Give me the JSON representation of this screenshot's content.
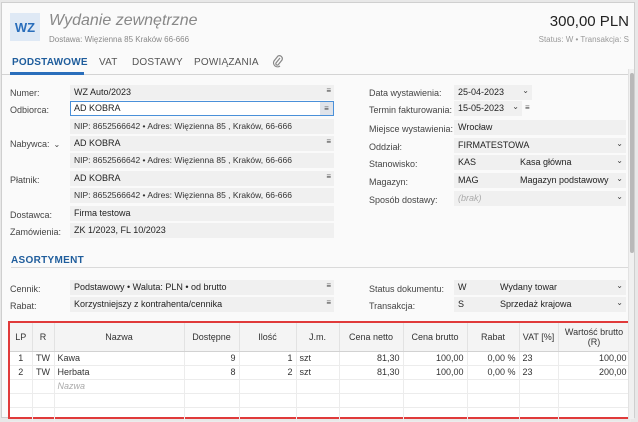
{
  "header": {
    "badge": "WZ",
    "title": "Wydanie zewnętrzne",
    "delivery": "Dostawa: Więzienna  85  Kraków 66-666",
    "amount": "300,00 PLN",
    "status": "Status:  W  •  Transakcja:  S"
  },
  "tabs": [
    {
      "label": "PODSTAWOWE"
    },
    {
      "label": "VAT"
    },
    {
      "label": "DOSTAWY"
    },
    {
      "label": "POWIĄZANIA"
    }
  ],
  "left": {
    "numer_label": "Numer:",
    "numer_value": "WZ Auto/2023",
    "odbiorca_label": "Odbiorca:",
    "odbiorca_value": "AD KOBRA",
    "odbiorca_info": "NIP: 8652566642  •  Adres: Więzienna  85 , Kraków, 66-666",
    "nabywca_label": "Nabywca:",
    "nabywca_value": "AD KOBRA",
    "nabywca_info": "NIP: 8652566642  •  Adres: Więzienna  85 , Kraków, 66-666",
    "platnik_label": "Płatnik:",
    "platnik_value": "AD KOBRA",
    "platnik_info": "NIP: 8652566642  •  Adres: Więzienna  85 , Kraków, 66-666",
    "dostawca_label": "Dostawca:",
    "dostawca_value": "Firma testowa",
    "zamowienia_label": "Zamówienia:",
    "zamowienia_value": "ZK 1/2023, FL 10/2023"
  },
  "right": {
    "data_wyst_label": "Data wystawienia:",
    "data_wyst_value": "25-04-2023",
    "termin_label": "Termin fakturowania:",
    "termin_value": "15-05-2023",
    "miejsce_label": "Miejsce wystawienia:",
    "miejsce_value": "Wrocław",
    "oddzial_label": "Oddział:",
    "oddzial_value": "FIRMATESTOWA",
    "stanowisko_label": "Stanowisko:",
    "stanowisko_code": "KAS",
    "stanowisko_name": "Kasa główna",
    "magazyn_label": "Magazyn:",
    "magazyn_code": "MAG",
    "magazyn_name": "Magazyn podstawowy",
    "sposob_label": "Sposób dostawy:",
    "sposob_placeholder": "(brak)"
  },
  "asortyment": {
    "title": "ASORTYMENT",
    "cennik_label": "Cennik:",
    "cennik_value": "Podstawowy • Waluta: PLN • od brutto",
    "rabat_label": "Rabat:",
    "rabat_value": "Korzystniejszy z kontrahenta/cennika",
    "status_label": "Status dokumentu:",
    "status_code": "W",
    "status_name": "Wydany towar",
    "transakcja_label": "Transakcja:",
    "transakcja_code": "S",
    "transakcja_name": "Sprzedaż krajowa"
  },
  "grid": {
    "columns": [
      "LP",
      "R",
      "Nazwa",
      "Dostępne",
      "Ilość",
      "J.m.",
      "Cena netto",
      "Cena brutto",
      "Rabat",
      "VAT [%]",
      "Wartość brutto (R)"
    ],
    "rows": [
      {
        "lp": "1",
        "r": "TW",
        "nazwa": "Kawa",
        "dostepne": "9",
        "ilosc": "1",
        "jm": "szt",
        "netto": "81,30",
        "brutto": "100,00",
        "rabat": "0,00 %",
        "vat": "23",
        "wartosc": "100,00"
      },
      {
        "lp": "2",
        "r": "TW",
        "nazwa": "Herbata",
        "dostepne": "8",
        "ilosc": "2",
        "jm": "szt",
        "netto": "81,30",
        "brutto": "100,00",
        "rabat": "0,00 %",
        "vat": "23",
        "wartosc": "200,00"
      }
    ],
    "new_row_placeholder": "Nazwa"
  }
}
